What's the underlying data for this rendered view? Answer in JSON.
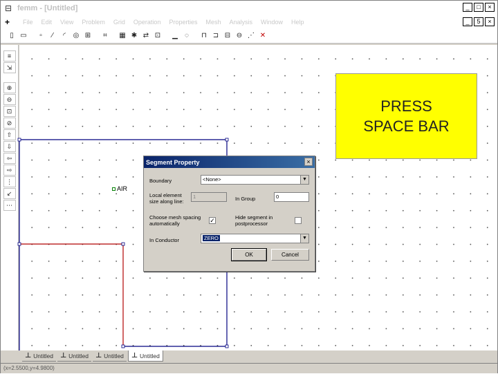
{
  "window": {
    "title": "femm - [Untitled]",
    "min": "_",
    "max": "□",
    "close": "×"
  },
  "menubar": {
    "items": [
      "File",
      "Edit",
      "View",
      "Problem",
      "Grid",
      "Operation",
      "Properties",
      "Mesh",
      "Analysis",
      "Window",
      "Help"
    ],
    "min": "_",
    "restore": "5",
    "close": "×"
  },
  "toolbar": {
    "icons": [
      "new-icon",
      "open-icon",
      "save-icon",
      "node-mode-icon",
      "segment-mode-icon",
      "arc-mode-icon",
      "block-mode-icon",
      "group-mode-icon",
      "mesh-icon",
      "analyze-icon",
      "view-results-icon",
      "move-icon",
      "copy-icon",
      "mirror-icon",
      "scale-icon",
      "fillet-icon",
      "select-window-icon",
      "delete-icon"
    ]
  },
  "canvas": {
    "node_label": "AIR",
    "notice_line1": "PRESS",
    "notice_line2": "SPACE BAR"
  },
  "dialog": {
    "title": "Segment Property",
    "close": "×",
    "boundary_label": "Boundary",
    "boundary_value": "<None>",
    "element_size_label_1": "Local element",
    "element_size_label_2": "size along line:",
    "element_size_value": "1",
    "in_group_label": "In Group",
    "in_group_value": "0",
    "mesh_spacing_label_1": "Choose mesh spacing",
    "mesh_spacing_label_2": "automatically",
    "mesh_spacing_checked": "✓",
    "hide_segment_label_1": "Hide segment in",
    "hide_segment_label_2": "postprocessor",
    "hide_segment_checked": "",
    "conductor_label": "In Conductor",
    "conductor_value": "ZERO",
    "ok_label": "OK",
    "cancel_label": "Cancel"
  },
  "tabs": [
    {
      "label": "Untitled"
    },
    {
      "label": "Untitled"
    },
    {
      "label": "Untitled"
    },
    {
      "label": "Untitled"
    }
  ],
  "status": {
    "text": "(x=2.5500,y=4.9800)"
  },
  "colors": {
    "outer_box": "#00007f",
    "inner_lines": "#b00000",
    "notice_bg": "#ffff00",
    "dialog_title": "#0a246a"
  }
}
